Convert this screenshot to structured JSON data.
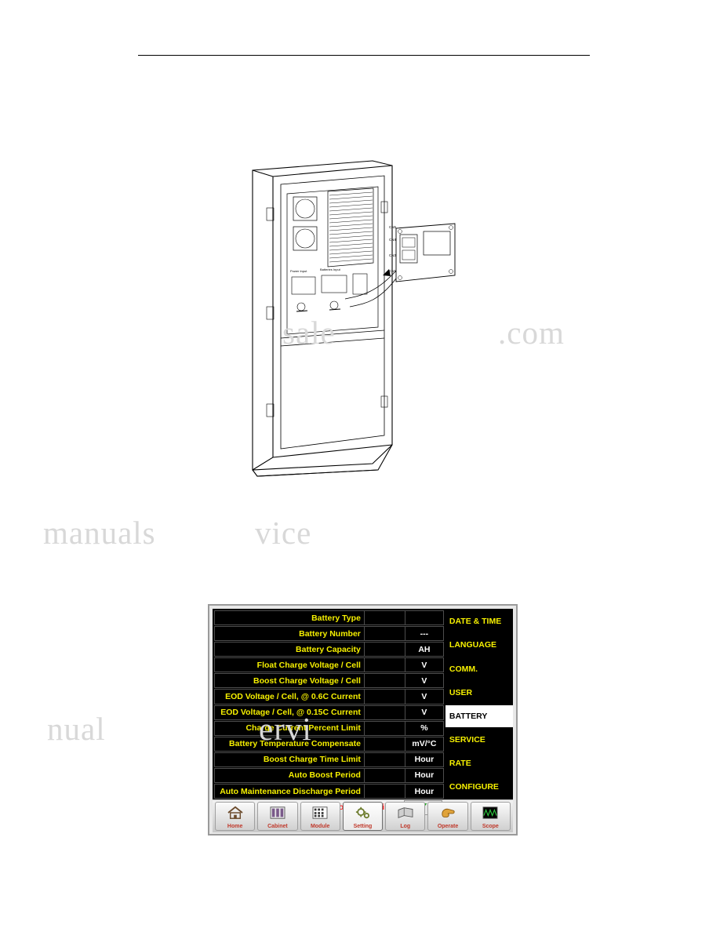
{
  "document": {
    "has_header_rule": true,
    "watermark_lines": [
      "sale",
      ".com",
      "manuals",
      "vice",
      "nual",
      "ervi"
    ]
  },
  "figure": {
    "caption": "",
    "callouts": [
      "CN5",
      "CN4",
      "CN3",
      "CN1"
    ],
    "panel_labels": [
      "Power Input",
      "Batteries Input"
    ]
  },
  "lcd": {
    "parameters": [
      {
        "label": "Battery Type",
        "value": "",
        "unit": ""
      },
      {
        "label": "Battery Number",
        "value": "",
        "unit": "---"
      },
      {
        "label": "Battery Capacity",
        "value": "",
        "unit": "AH"
      },
      {
        "label": "Float Charge Voltage / Cell",
        "value": "",
        "unit": "V"
      },
      {
        "label": "Boost Charge Voltage / Cell",
        "value": "",
        "unit": "V"
      },
      {
        "label": "EOD Voltage / Cell, @ 0.6C Current",
        "value": "",
        "unit": "V"
      },
      {
        "label": "EOD Voltage / Cell, @ 0.15C Current",
        "value": "",
        "unit": "V"
      },
      {
        "label": "Charge Current Percent Limit",
        "value": "",
        "unit": "%"
      },
      {
        "label": "Battery Temperature Compensate",
        "value": "",
        "unit": "mV/°C"
      },
      {
        "label": "Boost Charge Time Limit",
        "value": "",
        "unit": "Hour"
      },
      {
        "label": "Auto Boost Period",
        "value": "",
        "unit": "Hour"
      },
      {
        "label": "Auto Maintenance Discharge Period",
        "value": "",
        "unit": "Hour"
      }
    ],
    "confirm": {
      "text": "Please Confirm Settings",
      "icon": "check-icon"
    },
    "menu": [
      {
        "label": "DATE & TIME",
        "selected": false
      },
      {
        "label": "LANGUAGE",
        "selected": false
      },
      {
        "label": "COMM.",
        "selected": false
      },
      {
        "label": "USER",
        "selected": false
      },
      {
        "label": "BATTERY",
        "selected": true
      },
      {
        "label": "SERVICE",
        "selected": false
      },
      {
        "label": "RATE",
        "selected": false
      },
      {
        "label": "CONFIGURE",
        "selected": false
      }
    ],
    "nav": [
      {
        "label": "Home",
        "icon": "home-icon",
        "active": false
      },
      {
        "label": "Cabinet",
        "icon": "cabinet-icon",
        "active": false
      },
      {
        "label": "Module",
        "icon": "module-icon",
        "active": false
      },
      {
        "label": "Setting",
        "icon": "gear-icon",
        "active": true
      },
      {
        "label": "Log",
        "icon": "log-icon",
        "active": false
      },
      {
        "label": "Operate",
        "icon": "hand-icon",
        "active": false
      },
      {
        "label": "Scope",
        "icon": "scope-icon",
        "active": false
      }
    ],
    "colors": {
      "label_text": "#f6f000",
      "unit_text": "#ffffff",
      "confirm_text": "#ff2d2d",
      "check": "#1faa1f",
      "nav_label": "#c0392b",
      "screen_bg": "#000000"
    }
  }
}
